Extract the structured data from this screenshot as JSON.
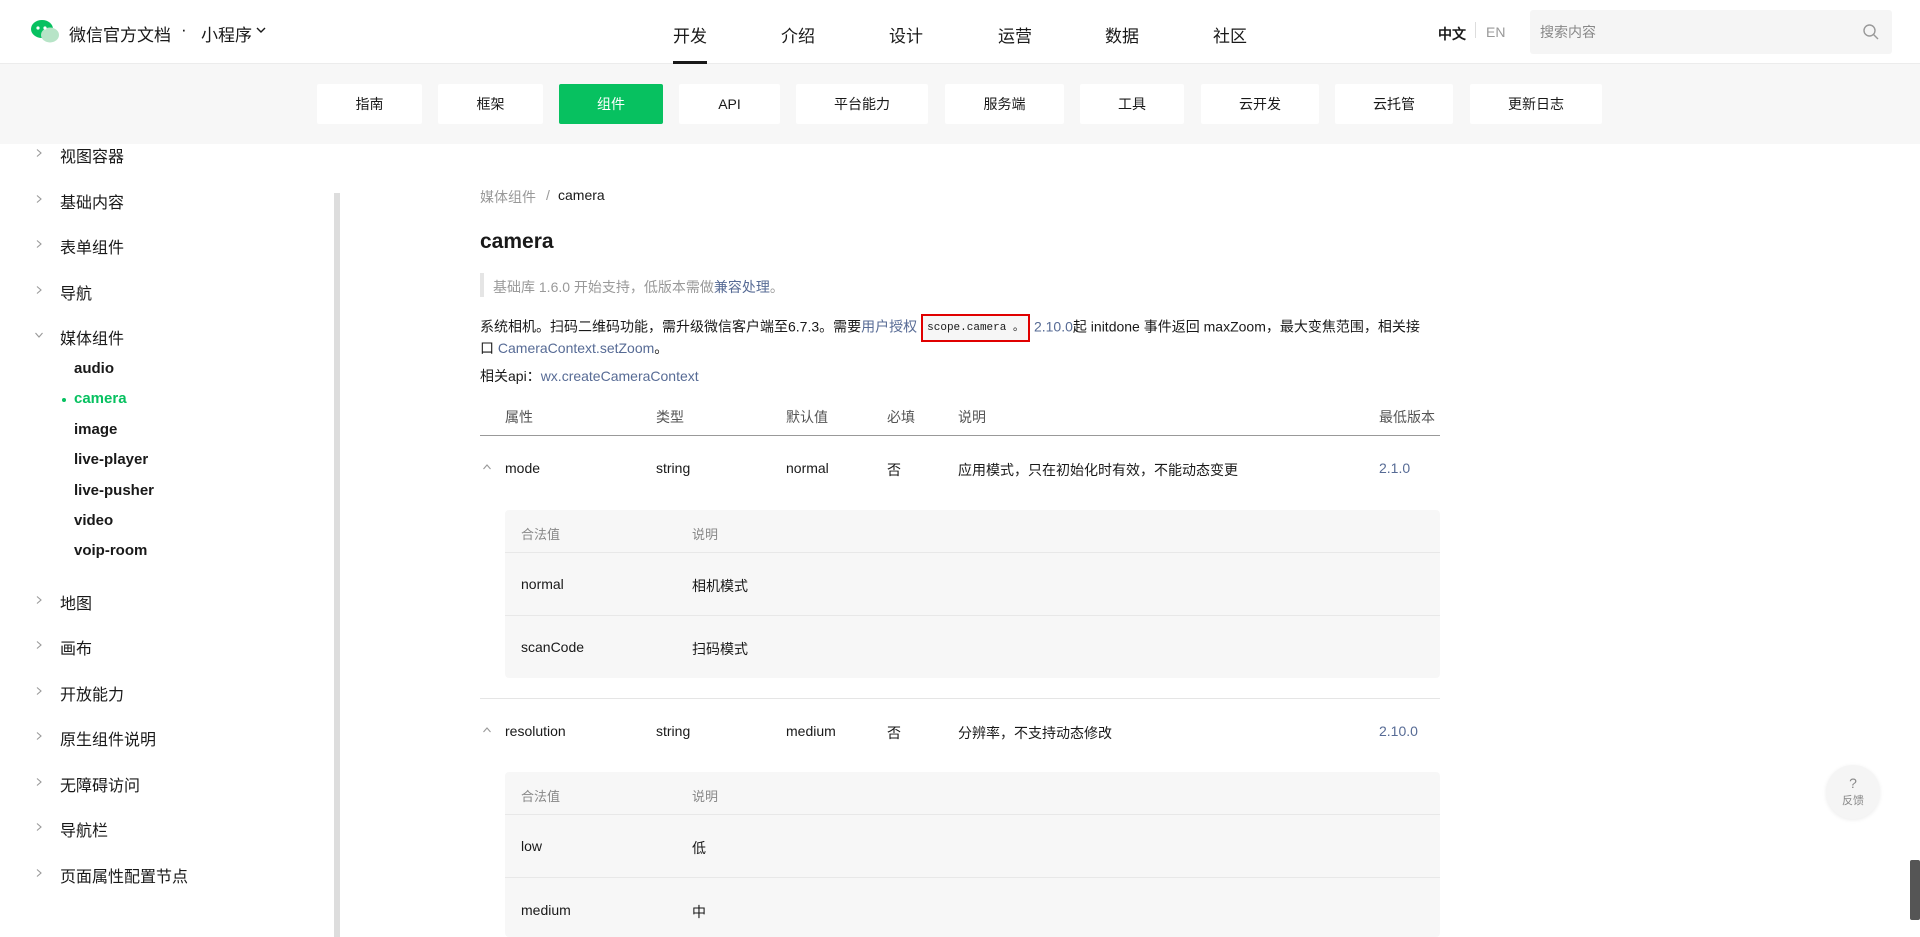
{
  "header": {
    "brand": "微信官方文档",
    "dot": "·",
    "product": "小程序",
    "nav": [
      {
        "label": "开发",
        "active": true
      },
      {
        "label": "介绍"
      },
      {
        "label": "设计"
      },
      {
        "label": "运营"
      },
      {
        "label": "数据"
      },
      {
        "label": "社区"
      }
    ],
    "lang_zh": "中文",
    "lang_en": "EN",
    "search_placeholder": "搜索内容"
  },
  "subnav": [
    {
      "label": "指南"
    },
    {
      "label": "框架"
    },
    {
      "label": "组件",
      "active": true
    },
    {
      "label": "API"
    },
    {
      "label": "平台能力"
    },
    {
      "label": "服务端"
    },
    {
      "label": "工具"
    },
    {
      "label": "云开发"
    },
    {
      "label": "云托管"
    },
    {
      "label": "更新日志"
    }
  ],
  "sidebar": {
    "items_top": [
      "视图容器",
      "基础内容",
      "表单组件",
      "导航",
      "媒体组件"
    ],
    "media_children": [
      "audio",
      "camera",
      "image",
      "live-player",
      "live-pusher",
      "video",
      "voip-room"
    ],
    "active_child": "camera",
    "items_bottom": [
      "地图",
      "画布",
      "开放能力",
      "原生组件说明",
      "无障碍访问",
      "导航栏",
      "页面属性配置节点"
    ]
  },
  "content": {
    "breadcrumb_parent": "媒体组件",
    "breadcrumb_sep": "/",
    "breadcrumb_current": "camera",
    "title": "camera",
    "note_prefix": "基础库 1.6.0 开始支持，低版本需做",
    "note_link": "兼容处理",
    "note_suffix": "。",
    "desc_part1": "系统相机。扫码二维码功能，需升级微信客户端至6.7.3。需要",
    "desc_link_auth": "用户授权",
    "desc_code": "scope.camera",
    "desc_dot": "。",
    "desc_version_link": "2.10.0",
    "desc_part2": "起 initdone 事件返回 maxZoom，最大变焦范围，相关接",
    "desc_part3_prefix": "口 ",
    "desc_link_zoom": "CameraContext.setZoom",
    "desc_part3_suffix": "。",
    "related_label": "相关api：",
    "related_link": "wx.createCameraContext"
  },
  "table": {
    "headers": [
      "属性",
      "类型",
      "默认值",
      "必填",
      "说明",
      "最低版本"
    ],
    "rows": [
      {
        "name": "mode",
        "type": "string",
        "default": "normal",
        "required": "否",
        "desc": "应用模式，只在初始化时有效，不能动态变更",
        "version": "2.1.0",
        "sub_headers": [
          "合法值",
          "说明"
        ],
        "sub_rows": [
          [
            "normal",
            "相机模式"
          ],
          [
            "scanCode",
            "扫码模式"
          ]
        ]
      },
      {
        "name": "resolution",
        "type": "string",
        "default": "medium",
        "required": "否",
        "desc": "分辨率，不支持动态修改",
        "version": "2.10.0",
        "sub_headers": [
          "合法值",
          "说明"
        ],
        "sub_rows": [
          [
            "low",
            "低"
          ],
          [
            "medium",
            "中"
          ]
        ]
      }
    ]
  },
  "feedback": {
    "icon": "?",
    "label": "反馈"
  },
  "colors": {
    "brand_green": "#07c160",
    "link": "#576b95",
    "highlight_red": "#e00000"
  }
}
